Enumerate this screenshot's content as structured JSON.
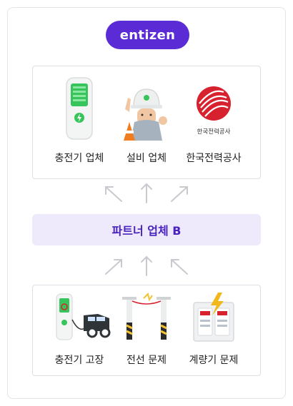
{
  "brand": {
    "label": "entizen"
  },
  "top_group": {
    "items": [
      {
        "label": "충전기 업체",
        "icon": "charger-icon"
      },
      {
        "label": "설비 업체",
        "icon": "worker-icon"
      },
      {
        "label": "한국전력공사",
        "icon": "kepco-logo",
        "logo_text": "한국전력공사"
      }
    ]
  },
  "partner": {
    "label": "파트너 업체 B"
  },
  "bottom_group": {
    "items": [
      {
        "label": "충전기 고장",
        "icon": "broken-charger-icon"
      },
      {
        "label": "전선 문제",
        "icon": "power-line-icon"
      },
      {
        "label": "계량기 문제",
        "icon": "meter-icon"
      }
    ]
  },
  "colors": {
    "brand": "#5b2bd6",
    "partner_bg": "#eeeafc",
    "partner_text": "#4a22c0",
    "charger_green": "#37c45a",
    "kepco_red": "#d8212e",
    "arrow": "#c9c9cf"
  }
}
